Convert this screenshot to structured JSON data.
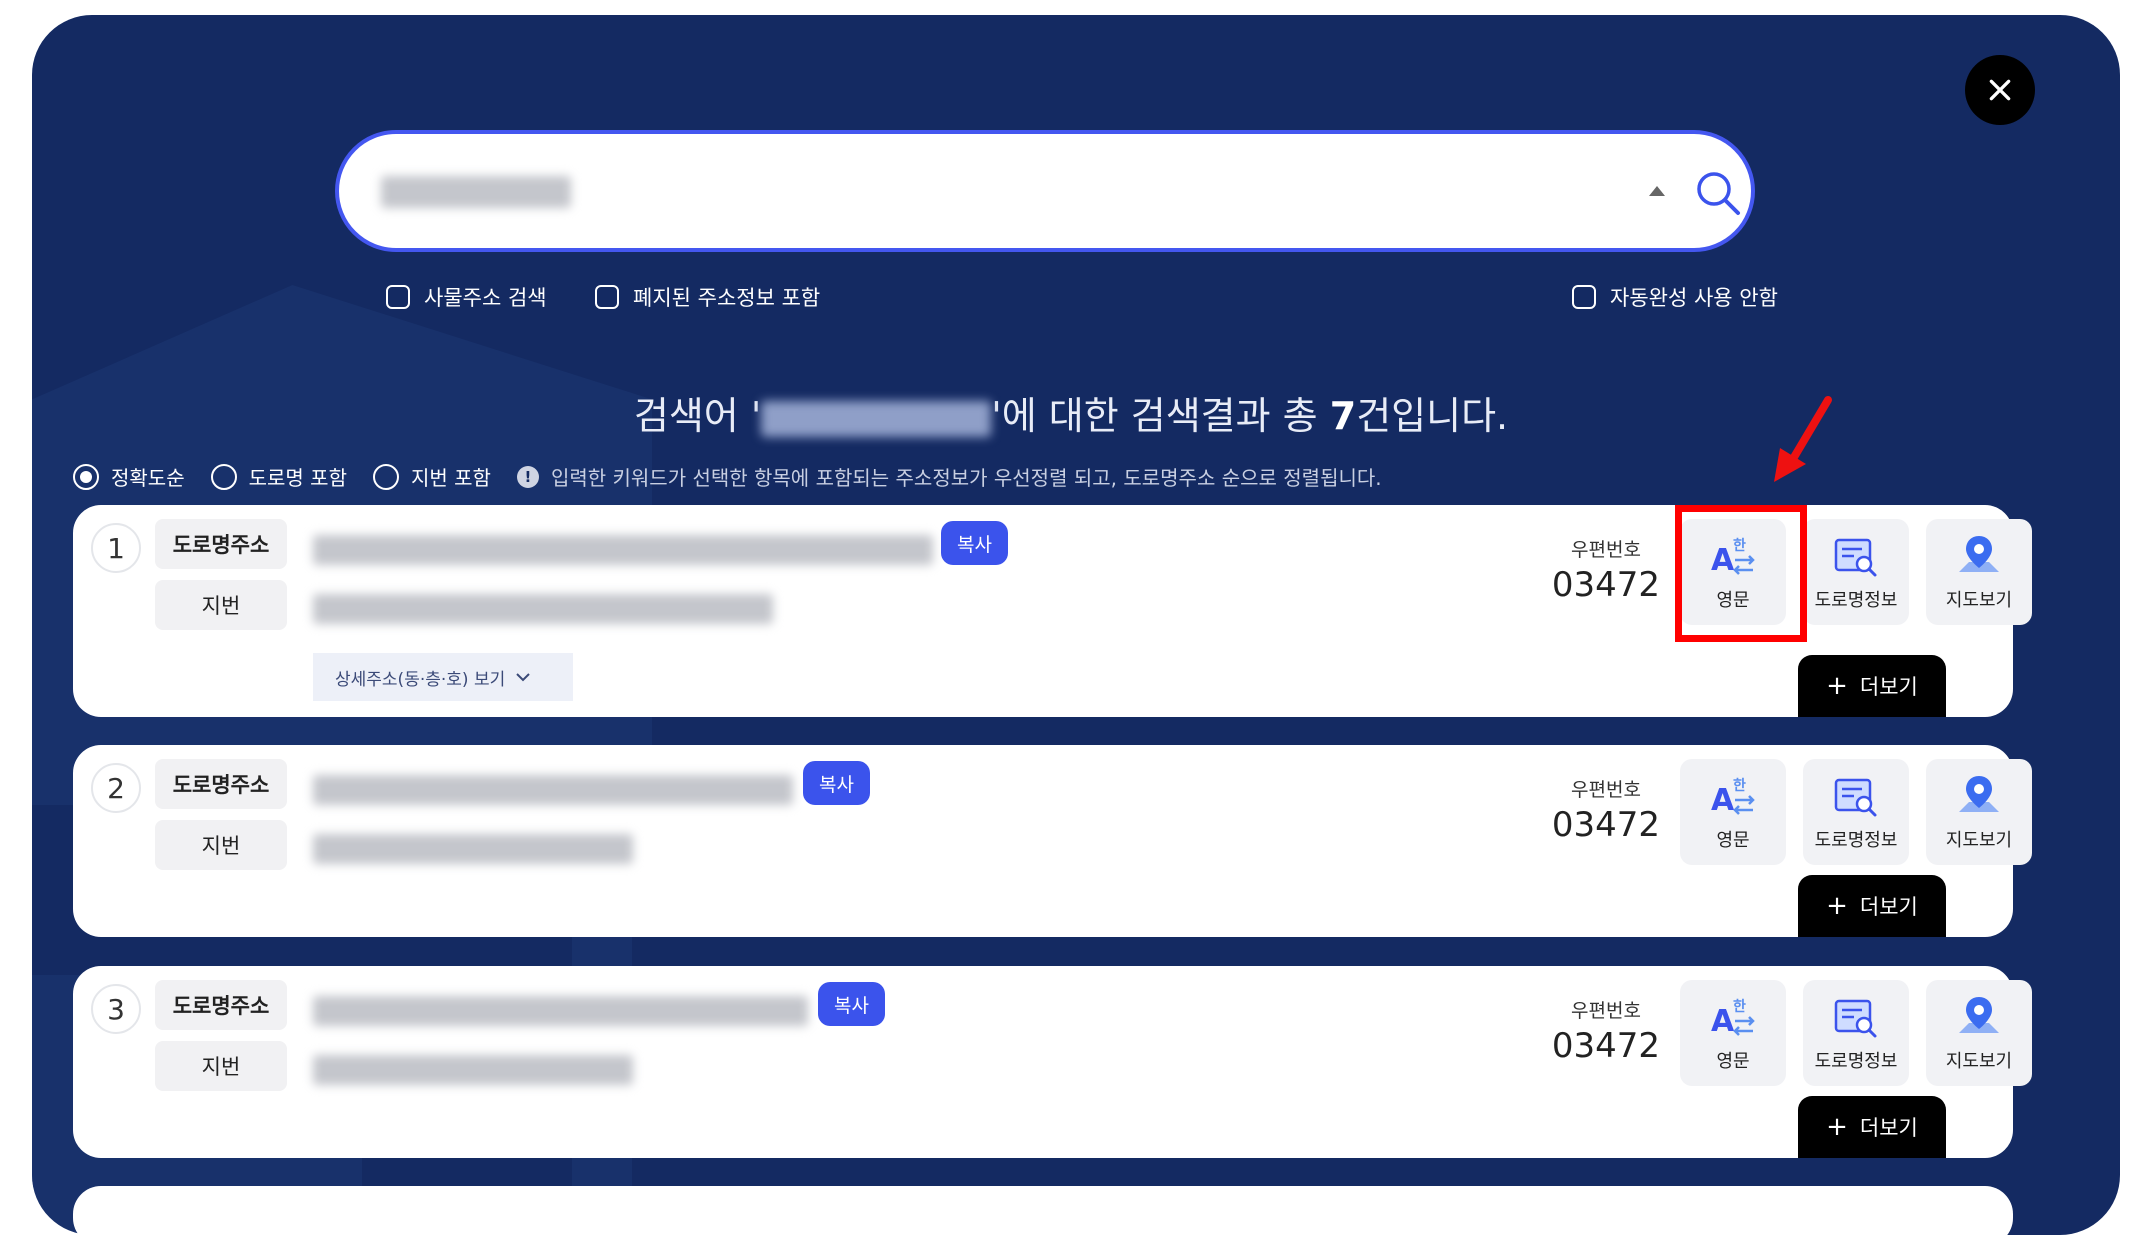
{
  "close": {
    "icon": "close-icon"
  },
  "search": {
    "placeholder": "",
    "value": "",
    "icons": {
      "toggle": "caret-up-icon",
      "submit": "search-icon"
    }
  },
  "options": {
    "building_search": "사물주소 검색",
    "abolished_info": "폐지된 주소정보 포함",
    "autocomplete_off": "자동완성 사용 안함"
  },
  "results": {
    "prefix": "검색어 '",
    "middle": "'에 대한 검색결과 총 ",
    "count": "7",
    "suffix": "건입니다."
  },
  "sort": {
    "options": [
      "정확도순",
      "도로명 포함",
      "지번 포함"
    ],
    "selected": "정확도순",
    "info": "입력한 키워드가 선택한 항목에 포함되는 주소정보가 우선정렬 되고, 도로명주소 순으로 정렬됩니다."
  },
  "labels": {
    "road": "도로명주소",
    "jibun": "지번",
    "copy": "복사",
    "detail": "상세주소(동·층·호) 보기",
    "zip": "우편번호",
    "english": "영문",
    "road_info": "도로명정보",
    "map": "지도보기",
    "more": "더보기"
  },
  "items": [
    {
      "no": "1",
      "zip": "03472"
    },
    {
      "no": "2",
      "zip": "03472"
    },
    {
      "no": "3",
      "zip": "03472"
    }
  ],
  "colors": {
    "panel_bg": "#142a62",
    "accent_blue": "#3b53ec",
    "highlight": "#ff0000"
  }
}
